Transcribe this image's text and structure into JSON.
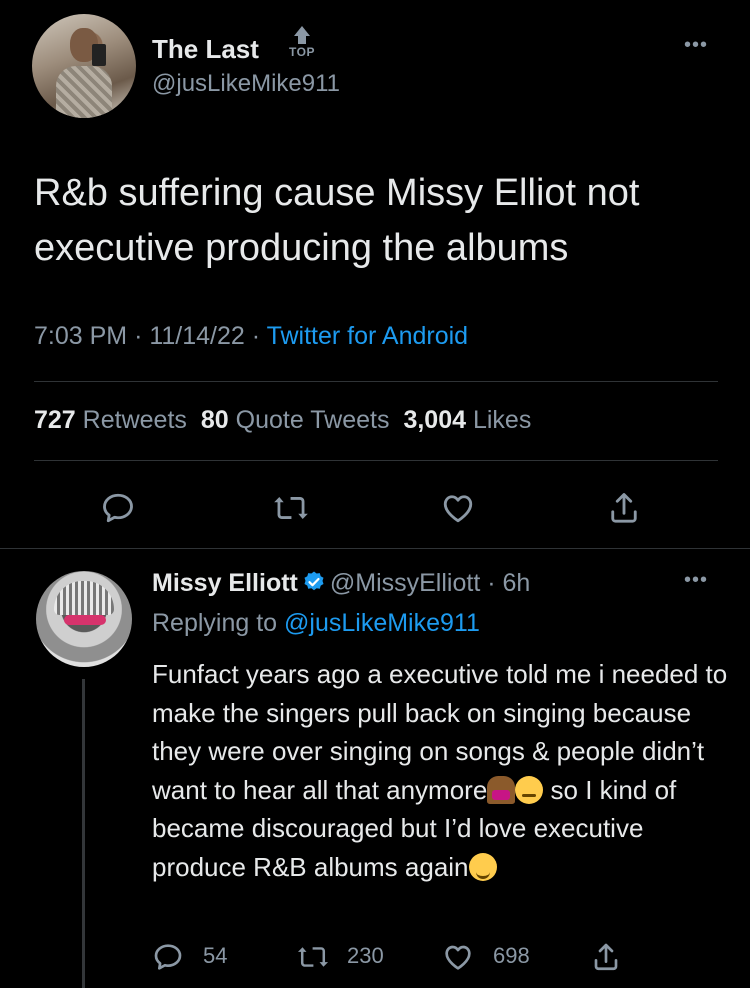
{
  "main_tweet": {
    "display_name": "The Last",
    "badge_label": "TOP",
    "handle": "@jusLikeMike911",
    "text": "R&b suffering cause Missy Elliot not executive producing the albums",
    "time": "7:03 PM",
    "date": "11/14/22",
    "source": "Twitter for Android",
    "retweets_count": "727",
    "retweets_label": "Retweets",
    "quotes_count": "80",
    "quotes_label": "Quote Tweets",
    "likes_count": "3,004",
    "likes_label": "Likes",
    "more_label": "•••"
  },
  "reply": {
    "display_name": "Missy Elliott",
    "handle": "@MissyElliott",
    "age": "6h",
    "replying_prefix": "Replying to",
    "replying_to": "@jusLikeMike911",
    "text_part1": "Funfact years ago a executive told me i needed to make the singers pull back on singing because they were over singing on songs & people didn’t want to hear all that anymore",
    "text_part2": " so I kind of became discouraged but I’d love executive produce R&B albums again",
    "reply_count": "54",
    "retweet_count": "230",
    "like_count": "698",
    "more_label": "•••"
  },
  "icons": {
    "reply": "reply-icon",
    "retweet": "retweet-icon",
    "like": "heart-icon",
    "share": "share-icon",
    "verified": "verified-badge-icon",
    "emojis": [
      "person-shrugging-emoji",
      "pensive-face-emoji",
      "relieved-face-emoji"
    ]
  },
  "colors": {
    "background": "#000000",
    "text": "#e7e9ea",
    "secondary": "#8b98a5",
    "accent": "#1d9bf0",
    "divider": "#2f3336"
  }
}
